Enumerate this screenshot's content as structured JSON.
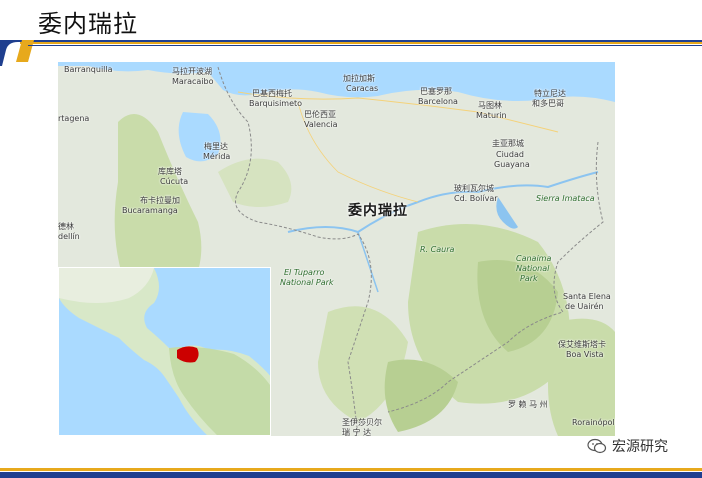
{
  "slide": {
    "title": "委内瑞拉"
  },
  "map": {
    "country_label": "委内瑞拉",
    "places": [
      {
        "id": "barranquilla",
        "text": "Barranquilla"
      },
      {
        "id": "maracaibo_cn",
        "text": "马拉开波湖"
      },
      {
        "id": "maracaibo",
        "text": "Maracaibo"
      },
      {
        "id": "barquisimeto_cn",
        "text": "巴基西梅托"
      },
      {
        "id": "barquisimeto",
        "text": "Barquisimeto"
      },
      {
        "id": "caracas_cn",
        "text": "加拉加斯"
      },
      {
        "id": "caracas",
        "text": "Caracas"
      },
      {
        "id": "barcelona_cn",
        "text": "巴塞罗那"
      },
      {
        "id": "barcelona",
        "text": "Barcelona"
      },
      {
        "id": "maturin_cn",
        "text": "马图林"
      },
      {
        "id": "maturin",
        "text": "Maturin"
      },
      {
        "id": "trinidad_cn",
        "text": "特立尼达"
      },
      {
        "id": "tobago_cn",
        "text": "和多巴哥"
      },
      {
        "id": "valencia_cn",
        "text": "巴伦西亚"
      },
      {
        "id": "valencia",
        "text": "Valencia"
      },
      {
        "id": "merida_cn",
        "text": "梅里达"
      },
      {
        "id": "merida",
        "text": "Mérida"
      },
      {
        "id": "cucuta_cn",
        "text": "库库塔"
      },
      {
        "id": "cucuta",
        "text": "Cúcuta"
      },
      {
        "id": "bucaramanga_cn",
        "text": "布卡拉曼加"
      },
      {
        "id": "bucaramanga",
        "text": "Bucaramanga"
      },
      {
        "id": "cartagena",
        "text": "rtagena"
      },
      {
        "id": "medellin_cn",
        "text": "德林"
      },
      {
        "id": "medellin",
        "text": "dellín"
      },
      {
        "id": "guayana_cn",
        "text": "圭亚那城"
      },
      {
        "id": "guayana1",
        "text": "Ciudad"
      },
      {
        "id": "guayana2",
        "text": "Guayana"
      },
      {
        "id": "bolivar_cn",
        "text": "玻利瓦尔城"
      },
      {
        "id": "bolivar",
        "text": "Cd. Bolívar"
      },
      {
        "id": "imataca",
        "text": "Sierra Imataca"
      },
      {
        "id": "tuparro1",
        "text": "El Tuparro"
      },
      {
        "id": "tuparro2",
        "text": "National Park"
      },
      {
        "id": "canaima1",
        "text": "Canaima"
      },
      {
        "id": "canaima2",
        "text": "National"
      },
      {
        "id": "canaima3",
        "text": "Park"
      },
      {
        "id": "elena1",
        "text": "Santa Elena"
      },
      {
        "id": "elena2",
        "text": "de Uairén"
      },
      {
        "id": "boavista_cn",
        "text": "保艾维斯塔卡"
      },
      {
        "id": "boavista",
        "text": "Boa Vista"
      },
      {
        "id": "cauca",
        "text": "R. Caura"
      },
      {
        "id": "roraima_cn",
        "text": "罗 赖 马 州"
      },
      {
        "id": "roraimapolis",
        "text": "Rorainópolis"
      },
      {
        "id": "santaisabel",
        "text": "圣伊莎贝尔"
      },
      {
        "id": "santaisabel2",
        "text": "瑞 宁 达"
      }
    ]
  },
  "watermark": {
    "text": "宏源研究",
    "icon": "wechat-icon"
  },
  "colors": {
    "title_band_blue": "#1f3f8f",
    "title_band_gold": "#e7a91c",
    "land": "#e3e8dd",
    "forest": "#c9dcaa",
    "water": "#aadaff",
    "highlight": "#cc0000"
  }
}
